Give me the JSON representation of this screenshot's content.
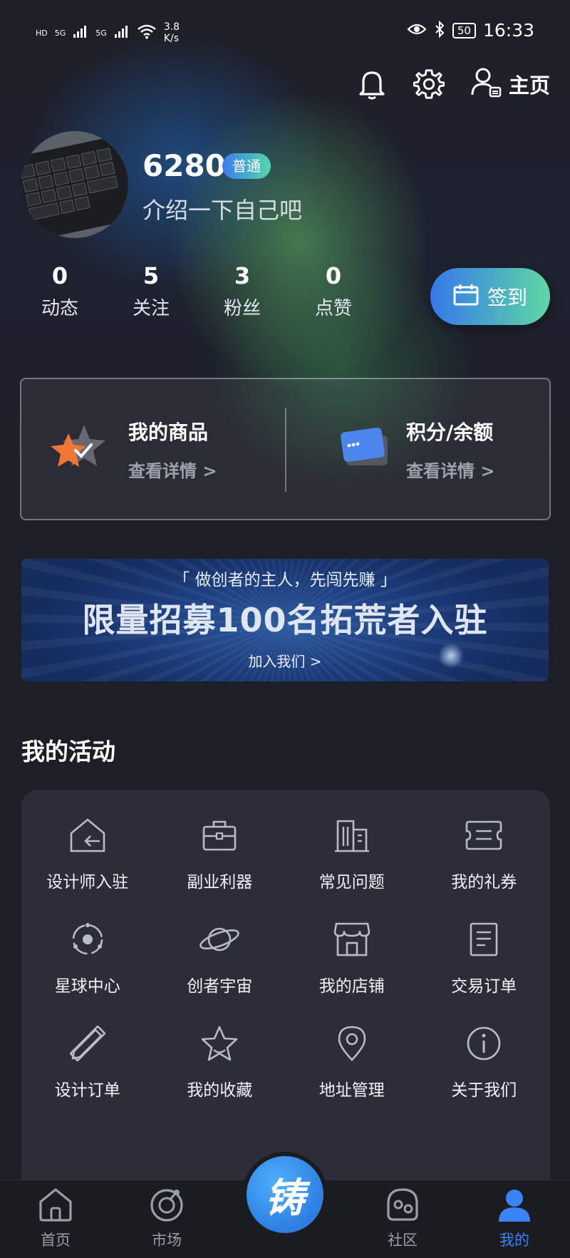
{
  "status_bar": {
    "network_labels": [
      "HD",
      "5G",
      "5G"
    ],
    "speed": "3.8",
    "speed_unit": "K/s",
    "battery": "50",
    "time": "16:33"
  },
  "header": {
    "home_label": "主页",
    "icons": [
      "bell-icon",
      "gear-icon",
      "user-profile-icon"
    ]
  },
  "profile": {
    "username": "6280",
    "level": "普通",
    "bio": "介绍一下自己吧"
  },
  "stats": [
    {
      "value": "0",
      "label": "动态"
    },
    {
      "value": "5",
      "label": "关注"
    },
    {
      "value": "3",
      "label": "粉丝"
    },
    {
      "value": "0",
      "label": "点赞"
    }
  ],
  "checkin": {
    "label": "签到"
  },
  "assets": {
    "goods": {
      "title": "我的商品",
      "link": "查看详情 >"
    },
    "balance": {
      "title": "积分/余额",
      "link": "查看详情 >"
    }
  },
  "banner": {
    "subtitle": "「 做创者的主人，先闯先赚 」",
    "headline": "限量招募100名拓荒者入驻",
    "cta": "加入我们 >"
  },
  "activities": {
    "title": "我的活动",
    "items": [
      {
        "label": "设计师入驻",
        "icon": "house-enter-icon"
      },
      {
        "label": "副业利器",
        "icon": "briefcase-icon"
      },
      {
        "label": "常见问题",
        "icon": "building-icon"
      },
      {
        "label": "我的礼券",
        "icon": "ticket-icon"
      },
      {
        "label": "星球中心",
        "icon": "orbit-icon"
      },
      {
        "label": "创者宇宙",
        "icon": "planet-icon"
      },
      {
        "label": "我的店铺",
        "icon": "store-icon"
      },
      {
        "label": "交易订单",
        "icon": "document-icon"
      },
      {
        "label": "设计订单",
        "icon": "pencil-ruler-icon"
      },
      {
        "label": "我的收藏",
        "icon": "star-icon"
      },
      {
        "label": "地址管理",
        "icon": "location-pin-icon"
      },
      {
        "label": "关于我们",
        "icon": "info-icon"
      }
    ]
  },
  "bottom_nav": {
    "items": [
      {
        "label": "首页",
        "icon": "home-icon"
      },
      {
        "label": "市场",
        "icon": "market-icon"
      },
      {
        "label": "社区",
        "icon": "community-icon"
      },
      {
        "label": "我的",
        "icon": "user-icon"
      }
    ],
    "center_glyph": "铸",
    "active_color": "#3b82f6"
  }
}
